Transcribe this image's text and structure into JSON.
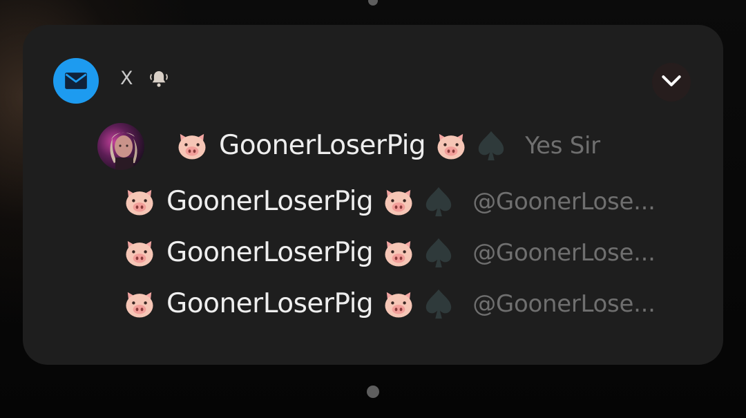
{
  "notification": {
    "app_icon": "mail-icon",
    "app_name": "X",
    "alert_icon": "bell-icon",
    "expand_icon": "chevron-down-icon",
    "accent_color": "#1d9bf0",
    "sender": {
      "name": "GoonerLoserPig",
      "prefix_emoji": "pig-face-emoji",
      "suffix_emoji": "pig-face-emoji",
      "extra_icon": "spade-icon",
      "message": "Yes Sir"
    },
    "items": [
      {
        "name": "GoonerLoserPig",
        "handle": "@GoonerLose..."
      },
      {
        "name": "GoonerLoserPig",
        "handle": "@GoonerLose..."
      },
      {
        "name": "GoonerLoserPig",
        "handle": "@GoonerLose..."
      }
    ]
  }
}
